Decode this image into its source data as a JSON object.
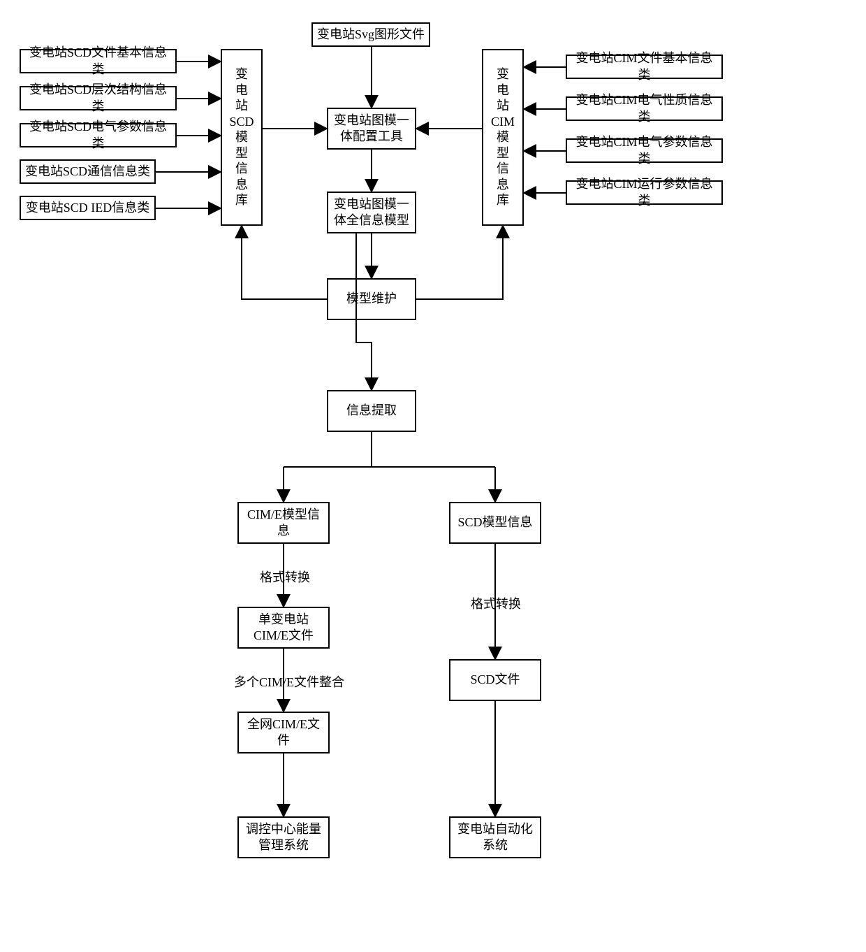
{
  "top": {
    "svg_file": "变电站Svg图形文件",
    "config_tool": "变电站图模一\n体配置工具",
    "full_model": "变电站图模一\n体全信息模型",
    "model_maint": "模型维护",
    "info_extract": "信息提取"
  },
  "scd": {
    "lib": "变电站SCD模型信息库",
    "lib_label_1": "变",
    "lib_label_2": "电",
    "lib_label_3": "站",
    "items": [
      "变电站SCD文件基本信息类",
      "变电站SCD层次结构信息类",
      "变电站SCD电气参数信息类",
      "变电站SCD通信信息类",
      "变电站SCD IED信息类"
    ]
  },
  "cim": {
    "lib": "变电站CIM模型信息库",
    "items": [
      "变电站CIM文件基本信息类",
      "变电站CIM电气性质信息类",
      "变电站CIM电气参数信息类",
      "变电站CIM运行参数信息类"
    ]
  },
  "left_chain": {
    "cime_info": "CIM/E模型信\n息",
    "format": "格式转换",
    "single": "单变电站\nCIM/E文件",
    "merge": "多个CIM/E文件整合",
    "full": "全网CIM/E文\n件",
    "ems": "调控中心能量\n管理系统"
  },
  "right_chain": {
    "scd_info": "SCD模型信息",
    "format": "格式转换",
    "scd_file": "SCD文件",
    "sas": "变电站自动化\n系统"
  }
}
